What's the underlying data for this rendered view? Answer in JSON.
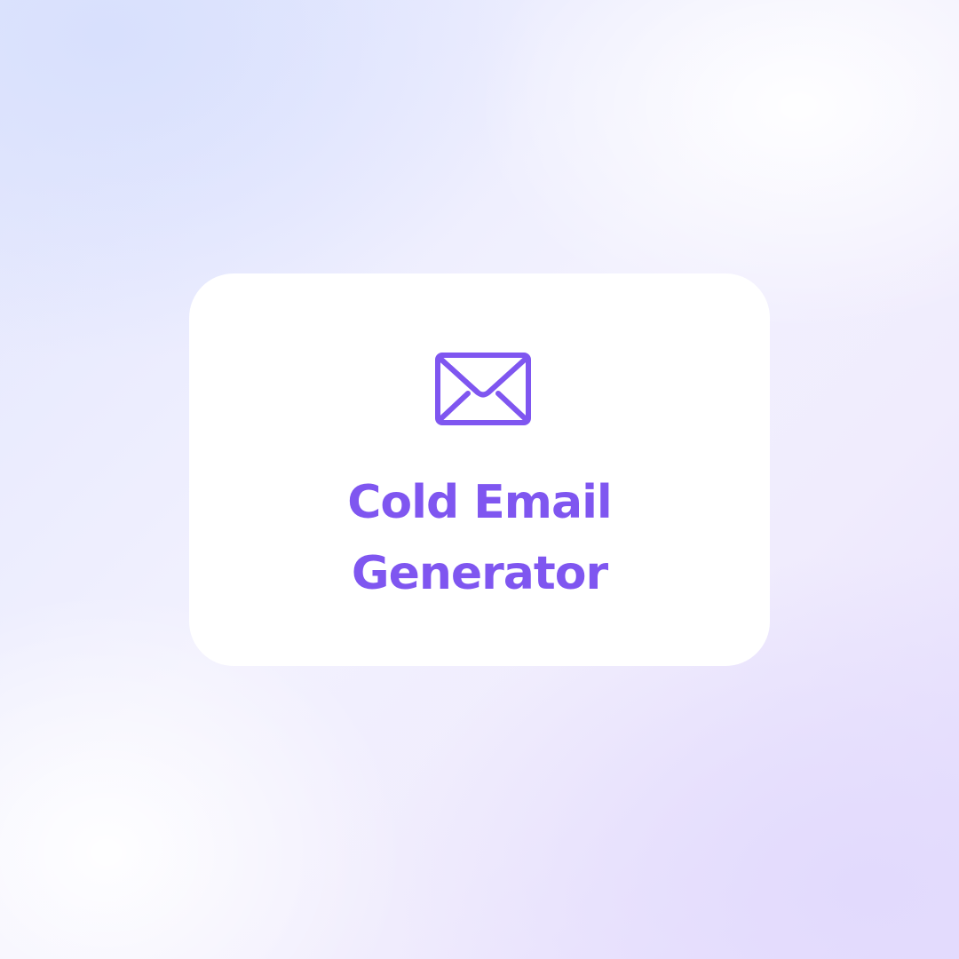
{
  "card": {
    "icon": "envelope-icon",
    "title_line_1": "Cold Email",
    "title_line_2": "Generator"
  },
  "colors": {
    "accent": "#7f56f0",
    "card_background": "#ffffff",
    "background_start": "#dde3fd",
    "background_end": "#e6defd"
  }
}
